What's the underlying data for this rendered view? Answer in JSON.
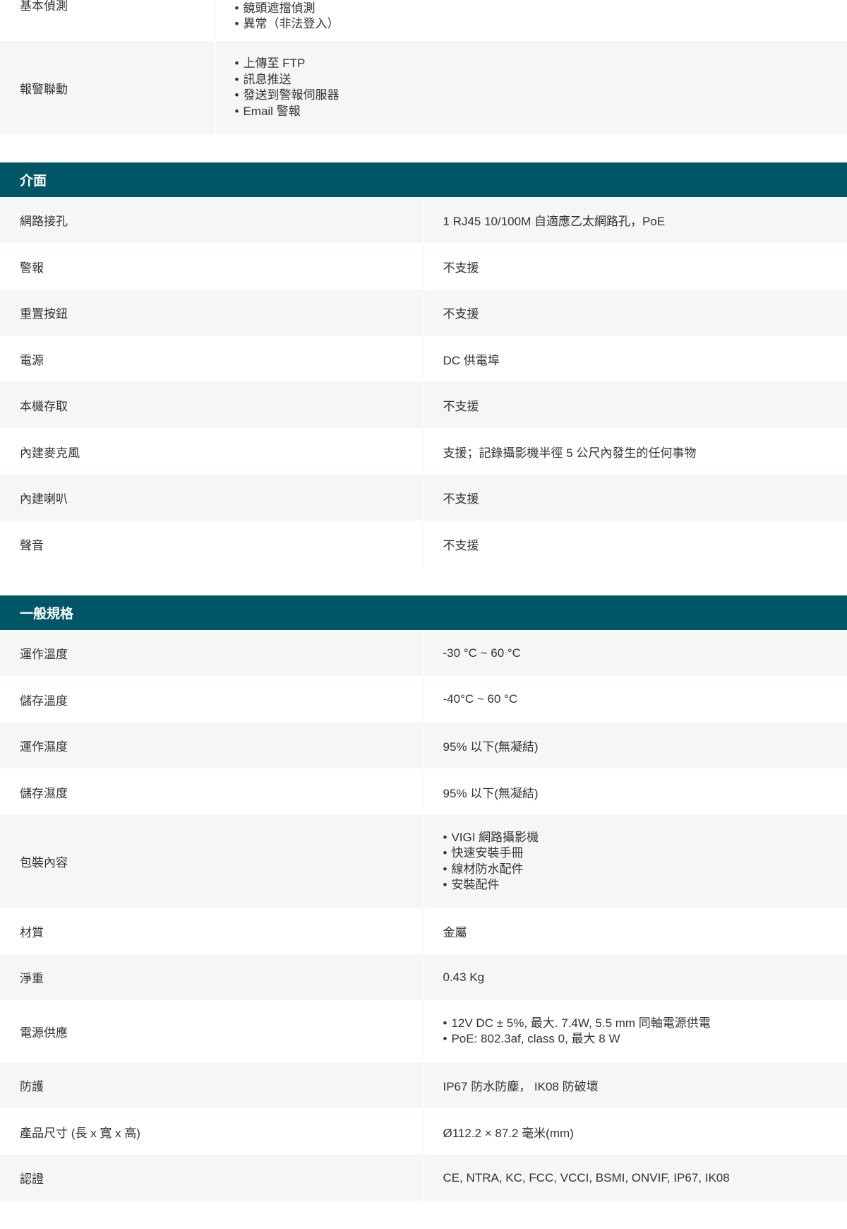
{
  "sections": {
    "top_partial": {
      "rows": [
        {
          "label": "基本偵測",
          "items": [
            "鏡頭遮擋偵測",
            "異常（非法登入）"
          ]
        },
        {
          "label": "報警聯動",
          "items": [
            "上傳至 FTP",
            "訊息推送",
            "發送到警報伺服器",
            "Email 警報"
          ]
        }
      ]
    },
    "interface": {
      "title": "介面",
      "rows": [
        {
          "label": "網路接孔",
          "value": "1 RJ45 10/100M 自適應乙太網路孔，PoE"
        },
        {
          "label": "警報",
          "value": "不支援"
        },
        {
          "label": "重置按鈕",
          "value": "不支援"
        },
        {
          "label": "電源",
          "value": "DC 供電埠"
        },
        {
          "label": "本機存取",
          "value": "不支援"
        },
        {
          "label": "內建麥克風",
          "value": "支援；記錄攝影機半徑 5 公尺內發生的任何事物"
        },
        {
          "label": "內建喇叭",
          "value": "不支援"
        },
        {
          "label": "聲音",
          "value": "不支援"
        }
      ]
    },
    "general": {
      "title": "一般規格",
      "rows": [
        {
          "label": "運作溫度",
          "value": "-30 °C ~ 60 °C"
        },
        {
          "label": "儲存溫度",
          "value": "-40°C ~ 60 °C"
        },
        {
          "label": "運作濕度",
          "value": "95% 以下(無凝結)"
        },
        {
          "label": "儲存濕度",
          "value": "95% 以下(無凝結)"
        },
        {
          "label": "包裝內容",
          "items": [
            "VIGI 網路攝影機",
            "快速安裝手冊",
            "線材防水配件",
            "安裝配件"
          ]
        },
        {
          "label": "材質",
          "value": "金屬"
        },
        {
          "label": "淨重",
          "value": "0.43 Kg"
        },
        {
          "label": "電源供應",
          "items": [
            "12V DC ± 5%, 最大. 7.4W, 5.5 mm 同軸電源供電",
            "PoE: 802.3af, class 0, 最大 8 W"
          ]
        },
        {
          "label": "防護",
          "value": "IP67 防水防塵， IK08 防破壞"
        },
        {
          "label": "產品尺寸 (長 x 寬 x 高)",
          "value": "Ø112.2 × 87.2 毫米(mm)"
        },
        {
          "label": "認證",
          "value": "CE, NTRA, KC, FCC, VCCI, BSMI, ONVIF, IP67, IK08"
        }
      ]
    }
  }
}
